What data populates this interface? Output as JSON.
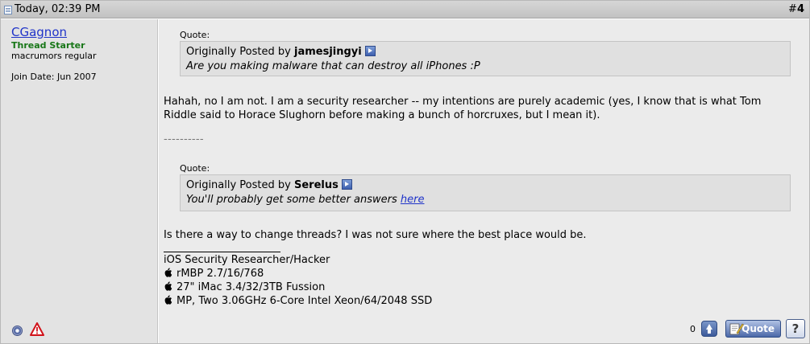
{
  "header": {
    "date": "Today, 02:39 PM",
    "post_number_prefix": "#",
    "post_number": "4"
  },
  "user": {
    "name": "CGagnon",
    "title": "Thread Starter",
    "rank": "macrumors regular",
    "join_date": "Join Date: Jun 2007"
  },
  "quotes": [
    {
      "label": "Quote:",
      "posted_by_prefix": "Originally Posted by",
      "author": "jamesjingyi",
      "text": "Are you making malware that can destroy all iPhones :P"
    },
    {
      "label": "Quote:",
      "posted_by_prefix": "Originally Posted by",
      "author": "Serelus",
      "text": "You'll probably get some better answers",
      "link_text": "here"
    }
  ],
  "message": {
    "paragraph1_line1": "Hahah, no I am not. I am a security researcher -- my intentions are purely academic (yes, I know that is what Tom",
    "paragraph1_line2": "Riddle said to Horace Slughorn before making a bunch of horcruxes, but I mean it).",
    "separator": "----------",
    "paragraph2": "Is there a way to change threads? I was not sure where the best place would be."
  },
  "signature": {
    "line1": "iOS Security Researcher/Hacker",
    "line2": "rMBP 2.7/16/768",
    "line3": "27\" iMac 3.4/32/3TB Fussion",
    "line4": "MP, Two 3.06GHz 6-Core Intel Xeon/64/2048 SSD"
  },
  "actions": {
    "like_count": "0",
    "quote_label": "Quote",
    "multi_quote_glyph": "?"
  },
  "colors": {
    "username": "#1f33c9",
    "user_title": "#177617",
    "header_bg": "#c8c8c8",
    "user_col_bg": "#e3e3e3",
    "content_bg": "#ebebeb"
  },
  "icons": {
    "post": "post-icon",
    "view_post": "view-post-icon",
    "status": "status-icon",
    "report": "report-icon",
    "apple": "apple-icon",
    "arrow_up": "arrow-up-icon",
    "quote": "quote-icon",
    "multi_quote": "multi-quote-icon"
  }
}
